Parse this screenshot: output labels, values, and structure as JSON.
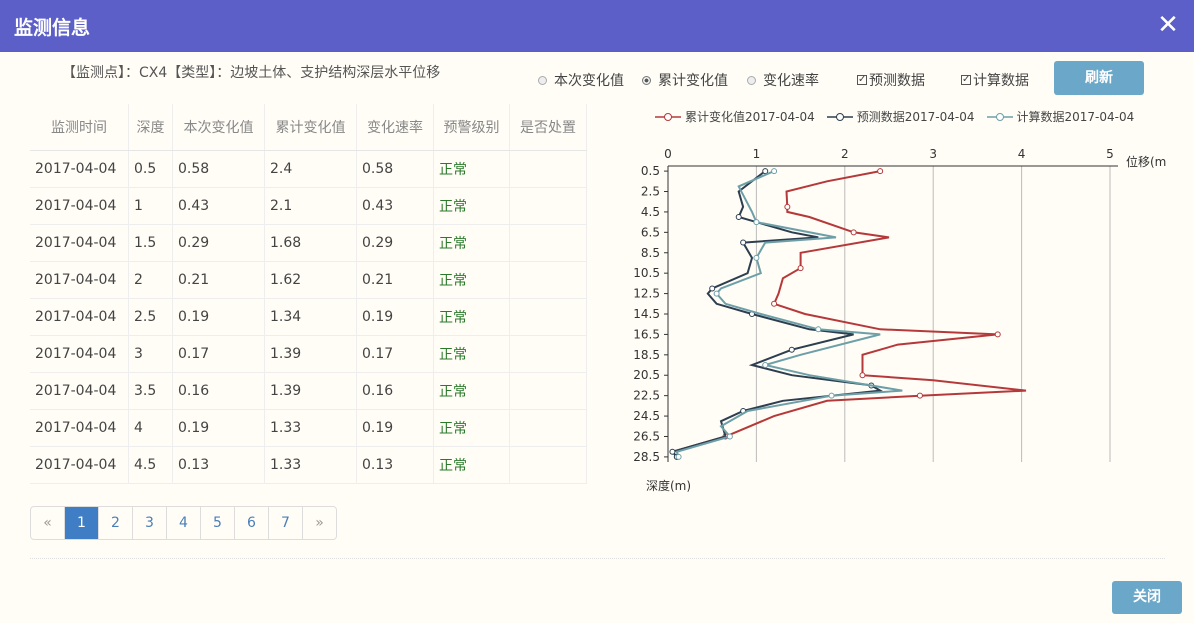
{
  "dialog": {
    "title": "监测信息",
    "close_icon": "✕"
  },
  "info_text": "【监测点】：CX4【类型】：边坡土体、支护结构深层水平位移",
  "options": {
    "radios": [
      {
        "label": "本次变化值",
        "checked": false
      },
      {
        "label": "累计变化值",
        "checked": true
      },
      {
        "label": "变化速率",
        "checked": false
      }
    ],
    "checkboxes": [
      {
        "label": "预测数据",
        "checked": true
      },
      {
        "label": "计算数据",
        "checked": true
      }
    ],
    "refresh_label": "刷新"
  },
  "table": {
    "headers": [
      "监测时间",
      "深度",
      "本次变化值",
      "累计变化值",
      "变化速率",
      "预警级别",
      "是否处置"
    ],
    "rows": [
      [
        "2017-04-04",
        "0.5",
        "0.58",
        "2.4",
        "0.58",
        "正常",
        ""
      ],
      [
        "2017-04-04",
        "1",
        "0.43",
        "2.1",
        "0.43",
        "正常",
        ""
      ],
      [
        "2017-04-04",
        "1.5",
        "0.29",
        "1.68",
        "0.29",
        "正常",
        ""
      ],
      [
        "2017-04-04",
        "2",
        "0.21",
        "1.62",
        "0.21",
        "正常",
        ""
      ],
      [
        "2017-04-04",
        "2.5",
        "0.19",
        "1.34",
        "0.19",
        "正常",
        ""
      ],
      [
        "2017-04-04",
        "3",
        "0.17",
        "1.39",
        "0.17",
        "正常",
        ""
      ],
      [
        "2017-04-04",
        "3.5",
        "0.16",
        "1.39",
        "0.16",
        "正常",
        ""
      ],
      [
        "2017-04-04",
        "4",
        "0.19",
        "1.33",
        "0.19",
        "正常",
        ""
      ],
      [
        "2017-04-04",
        "4.5",
        "0.13",
        "1.33",
        "0.13",
        "正常",
        ""
      ]
    ]
  },
  "pager": {
    "prev": "«",
    "pages": [
      "1",
      "2",
      "3",
      "4",
      "5",
      "6",
      "7"
    ],
    "active": "1",
    "next": "»"
  },
  "footer": {
    "close_label": "关闭"
  },
  "colors": {
    "titlebar": "#5b5fc7",
    "button": "#6aa7c8",
    "series1": "#b5393a",
    "series2": "#2c3e50",
    "series3": "#6d9fa8"
  },
  "chart_data": {
    "type": "line",
    "orientation": "vertical-depth",
    "xlabel": "位移(m",
    "ylabel": "深度(m)",
    "xlim": [
      0,
      5
    ],
    "xticks": [
      "0",
      "1",
      "2",
      "3",
      "4",
      "5"
    ],
    "ylim": [
      0,
      29
    ],
    "yticks": [
      "0.5",
      "2.5",
      "4.5",
      "6.5",
      "8.5",
      "10.5",
      "12.5",
      "14.5",
      "16.5",
      "18.5",
      "20.5",
      "22.5",
      "24.5",
      "26.5",
      "28.5"
    ],
    "series": [
      {
        "name": "累计变化值2017-04-04",
        "points": [
          [
            2.4,
            0.5
          ],
          [
            1.8,
            1.5
          ],
          [
            1.34,
            2.5
          ],
          [
            1.35,
            4
          ],
          [
            1.35,
            4.5
          ],
          [
            1.6,
            5
          ],
          [
            2.1,
            6.5
          ],
          [
            2.5,
            7
          ],
          [
            1.5,
            8.5
          ],
          [
            1.5,
            10
          ],
          [
            1.3,
            11
          ],
          [
            1.25,
            12.5
          ],
          [
            1.2,
            13.5
          ],
          [
            1.55,
            14.5
          ],
          [
            2.4,
            16
          ],
          [
            3.73,
            16.5
          ],
          [
            2.6,
            17.5
          ],
          [
            2.2,
            18.5
          ],
          [
            2.2,
            20.5
          ],
          [
            3.0,
            21
          ],
          [
            4.05,
            22
          ],
          [
            2.85,
            22.5
          ],
          [
            1.8,
            23
          ],
          [
            1.2,
            24.5
          ],
          [
            0.65,
            26.5
          ],
          [
            0.05,
            28
          ],
          [
            0.1,
            28.5
          ]
        ]
      },
      {
        "name": "预测数据2017-04-04",
        "points": [
          [
            1.1,
            0.5
          ],
          [
            0.8,
            2.5
          ],
          [
            0.85,
            4
          ],
          [
            0.8,
            5
          ],
          [
            1.4,
            6.5
          ],
          [
            1.7,
            7
          ],
          [
            0.85,
            7.5
          ],
          [
            0.95,
            9
          ],
          [
            0.9,
            10.5
          ],
          [
            0.5,
            12
          ],
          [
            0.45,
            12.5
          ],
          [
            0.55,
            13.5
          ],
          [
            0.95,
            14.5
          ],
          [
            1.6,
            16
          ],
          [
            2.1,
            16.5
          ],
          [
            1.4,
            18
          ],
          [
            0.95,
            19.5
          ],
          [
            1.4,
            20.5
          ],
          [
            2.3,
            21.5
          ],
          [
            2.4,
            22
          ],
          [
            1.3,
            23
          ],
          [
            0.85,
            24
          ],
          [
            0.6,
            25
          ],
          [
            0.65,
            26.5
          ],
          [
            0.05,
            28
          ],
          [
            0.1,
            28.5
          ]
        ]
      },
      {
        "name": "计算数据2017-04-04",
        "points": [
          [
            1.2,
            0.5
          ],
          [
            0.8,
            2
          ],
          [
            0.95,
            4.5
          ],
          [
            1.0,
            5.5
          ],
          [
            1.9,
            7
          ],
          [
            1.1,
            7.5
          ],
          [
            1.0,
            9
          ],
          [
            1.05,
            10.5
          ],
          [
            0.6,
            12
          ],
          [
            0.55,
            12.5
          ],
          [
            0.65,
            13.5
          ],
          [
            1.05,
            14.5
          ],
          [
            1.7,
            16
          ],
          [
            2.4,
            16.5
          ],
          [
            1.5,
            18.5
          ],
          [
            1.1,
            19.5
          ],
          [
            1.6,
            20.5
          ],
          [
            2.65,
            22
          ],
          [
            1.85,
            22.5
          ],
          [
            0.9,
            24
          ],
          [
            0.6,
            25.5
          ],
          [
            0.7,
            26.5
          ],
          [
            0.1,
            28
          ],
          [
            0.12,
            28.5
          ]
        ]
      }
    ]
  }
}
